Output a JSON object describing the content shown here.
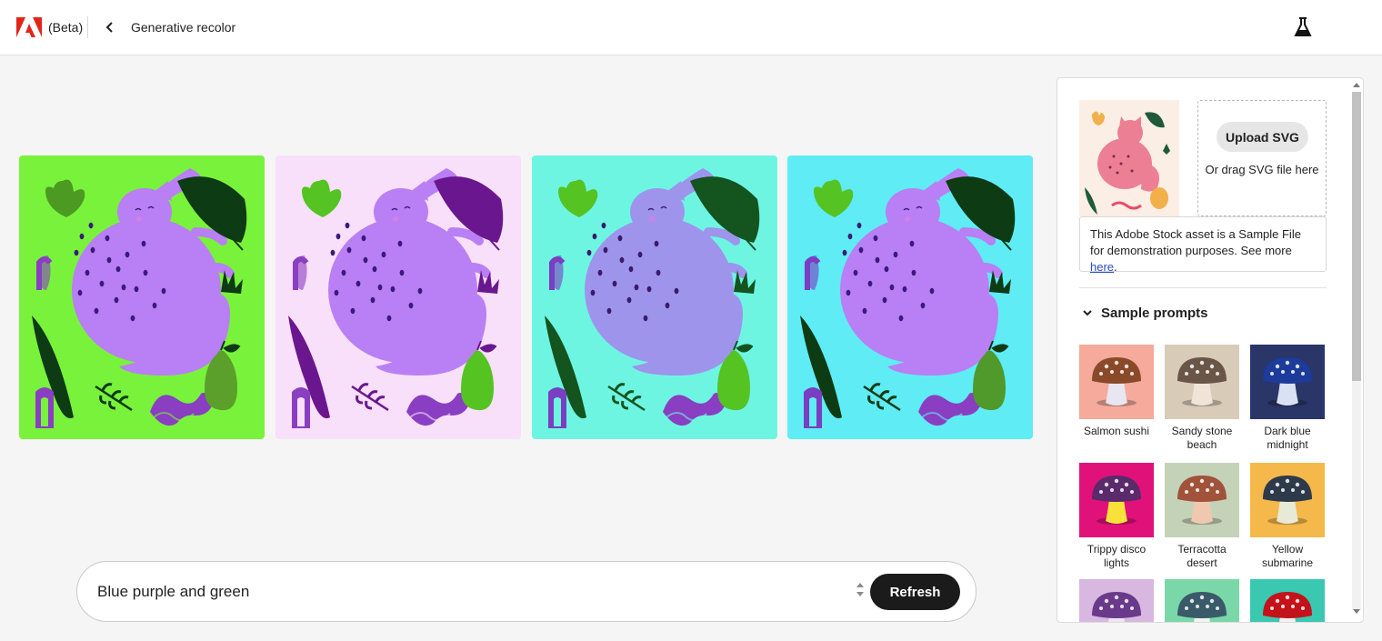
{
  "header": {
    "beta_label": "(Beta)",
    "page_title": "Generative recolor",
    "logo_icon": "adobe-logo",
    "back_icon": "chevron-left-icon",
    "labs_icon": "flask-icon"
  },
  "variants": [
    {
      "bg": "#79f23c",
      "cat": "#b97ff4",
      "spots": "#3a1a7a",
      "leaf_dark": "#0d3b14",
      "sprout": "#4c9a22",
      "pear": "#5aa02a",
      "arch": "#8a3ec2",
      "wave": "#8a3ec2"
    },
    {
      "bg": "#f8dffa",
      "cat": "#b97ff4",
      "spots": "#3a1a7a",
      "leaf_dark": "#6a178f",
      "sprout": "#55c322",
      "pear": "#55c322",
      "arch": "#8a3ec2",
      "wave": "#8a3ec2"
    },
    {
      "bg": "#6ef5e2",
      "cat": "#9e94ec",
      "spots": "#3a1a6a",
      "leaf_dark": "#13541f",
      "sprout": "#55c322",
      "pear": "#55c322",
      "arch": "#7a3ec2",
      "wave": "#8a3ec2"
    },
    {
      "bg": "#5fecf5",
      "cat": "#b97ff4",
      "spots": "#3a1a7a",
      "leaf_dark": "#0d3b14",
      "sprout": "#55c322",
      "pear": "#4f9a2a",
      "arch": "#7a3ec2",
      "wave": "#8a3ec2"
    }
  ],
  "prompt": {
    "value": "Blue purple and green",
    "refresh_label": "Refresh"
  },
  "panel": {
    "upload_label": "Upload SVG",
    "drag_text": "Or drag SVG file here",
    "notice_text": "This Adobe Stock asset is a Sample File for demonstration purposes. See more ",
    "notice_link": "here",
    "notice_end": ".",
    "sample_prompts_title": "Sample prompts",
    "collapse_icon": "chevron-down-icon",
    "sample_prompts": [
      {
        "label": "Salmon sushi",
        "bg": "#f5aa9c",
        "cap": "#8a4a2a",
        "stem": "#e8e6f0"
      },
      {
        "label": "Sandy stone beach",
        "bg": "#d8cbb8",
        "cap": "#6a5648",
        "stem": "#efe4d6"
      },
      {
        "label": "Dark blue midnight",
        "bg": "#2a3568",
        "cap": "#1c3b9a",
        "stem": "#d8e2f4"
      },
      {
        "label": "Trippy disco lights",
        "bg": "#e0127a",
        "cap": "#5a2a6a",
        "stem": "#f8e23a"
      },
      {
        "label": "Terracotta desert",
        "bg": "#c4d2b8",
        "cap": "#a0523a",
        "stem": "#f0c8b0"
      },
      {
        "label": "Yellow submarine",
        "bg": "#f5b84a",
        "cap": "#2e3a4a",
        "stem": "#e8ead8"
      },
      {
        "label": "",
        "bg": "#d8b8e0",
        "cap": "#6a3a8a",
        "stem": "#efe4f4"
      },
      {
        "label": "",
        "bg": "#7ad8a8",
        "cap": "#3a5a6a",
        "stem": "#eef4ee"
      },
      {
        "label": "",
        "bg": "#3ac8b0",
        "cap": "#c4121a",
        "stem": "#f4f0ee"
      }
    ]
  }
}
